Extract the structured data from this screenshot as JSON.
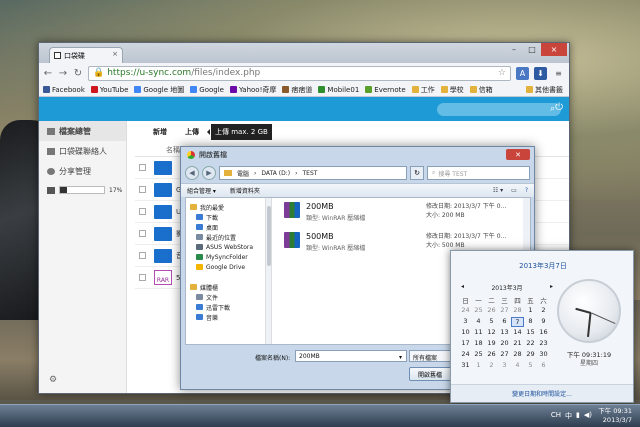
{
  "browser": {
    "tab_title": "口袋碟",
    "url_host": "https://u-sync.com",
    "url_path": "/files/index.php",
    "bookmarks": [
      {
        "label": "Facebook",
        "color": "#3b5998"
      },
      {
        "label": "YouTube",
        "color": "#cc181e"
      },
      {
        "label": "Google 地圖",
        "color": "#4285f4"
      },
      {
        "label": "Google",
        "color": "#4285f4"
      },
      {
        "label": "Yahoo!奇摩",
        "color": "#6b0aa8"
      },
      {
        "label": "痞痞道",
        "color": "#8a5a2a"
      },
      {
        "label": "Mobile01",
        "color": "#2f8f2f"
      },
      {
        "label": "Evernote",
        "color": "#5aa02c"
      },
      {
        "label": "工作",
        "color": "#e3b23c"
      },
      {
        "label": "學校",
        "color": "#e3b23c"
      },
      {
        "label": "信箱",
        "color": "#e3b23c"
      }
    ],
    "other_bookmarks": "其他書籤"
  },
  "app": {
    "nav": [
      {
        "label": "檔案總管"
      },
      {
        "label": "口袋碟聯絡人"
      },
      {
        "label": "分享管理"
      }
    ],
    "quota_percent": 17,
    "quota_label": "17%",
    "actions": {
      "new_label": "新增",
      "upload_label": "上傳",
      "upload_tooltip": "上傳 max. 2 GB"
    },
    "column_name": "名稱",
    "files": [
      {
        "name": "",
        "type": "folder"
      },
      {
        "name": "Ga",
        "type": "folder"
      },
      {
        "name": "U-",
        "type": "folder"
      },
      {
        "name": "影",
        "type": "folder"
      },
      {
        "name": "音",
        "type": "folder"
      },
      {
        "name": "50",
        "type": "rar"
      }
    ],
    "rar_badge": "RAR"
  },
  "dialog": {
    "title": "開啟舊檔",
    "breadcrumb": [
      "電腦",
      "DATA (D:)",
      "TEST"
    ],
    "search_placeholder": "搜尋 TEST",
    "cmd_organize": "組合管理 ▾",
    "cmd_newfolder": "新增資料夾",
    "tree": [
      {
        "label": "我的最愛",
        "color": "#e3b23c"
      },
      {
        "label": "下載",
        "color": "#3a7bd5"
      },
      {
        "label": "桌面",
        "color": "#3a7bd5"
      },
      {
        "label": "最近的位置",
        "color": "#7a8aa0"
      },
      {
        "label": "ASUS WebStora",
        "color": "#5a6a7a"
      },
      {
        "label": "MySyncFolder",
        "color": "#2a8a4a"
      },
      {
        "label": "Google Drive",
        "color": "#f4b400"
      },
      {
        "label": "",
        "color": "transparent"
      },
      {
        "label": "媒體櫃",
        "color": "#e3b23c"
      },
      {
        "label": "文件",
        "color": "#7a8aa0"
      },
      {
        "label": "迅雷下載",
        "color": "#3a7bd5"
      },
      {
        "label": "音樂",
        "color": "#3a7bd5"
      }
    ],
    "items": [
      {
        "name": "200MB",
        "type": "類型: WinRAR 壓縮檔",
        "modified": "修改日期: 2013/3/7 下午 0...",
        "size": "大小: 200 MB"
      },
      {
        "name": "500MB",
        "type": "類型: WinRAR 壓縮檔",
        "modified": "修改日期: 2013/3/7 下午 0...",
        "size": "大小: 500 MB"
      }
    ],
    "filename_label": "檔案名稱(N):",
    "filename_value": "200MB",
    "filetype": "所有檔案",
    "open_label": "開啟舊檔"
  },
  "calendar": {
    "long_date": "2013年3月7日",
    "month_label": "2013年3月",
    "weekdays": [
      "日",
      "一",
      "二",
      "三",
      "四",
      "五",
      "六"
    ],
    "weeks": [
      [
        "24",
        "25",
        "26",
        "27",
        "28",
        "1",
        "2"
      ],
      [
        "3",
        "4",
        "5",
        "6",
        "7",
        "8",
        "9"
      ],
      [
        "10",
        "11",
        "12",
        "13",
        "14",
        "15",
        "16"
      ],
      [
        "17",
        "18",
        "19",
        "20",
        "21",
        "22",
        "23"
      ],
      [
        "24",
        "25",
        "26",
        "27",
        "28",
        "29",
        "30"
      ],
      [
        "31",
        "1",
        "2",
        "3",
        "4",
        "5",
        "6"
      ]
    ],
    "today": "7",
    "time": "下午 09:31:19",
    "day": "星期四",
    "change_link": "變更日期和時間設定..."
  },
  "taskbar": {
    "time": "下午 09:31",
    "date": "2013/3/7",
    "tray_labels": [
      "CH",
      "中"
    ]
  }
}
